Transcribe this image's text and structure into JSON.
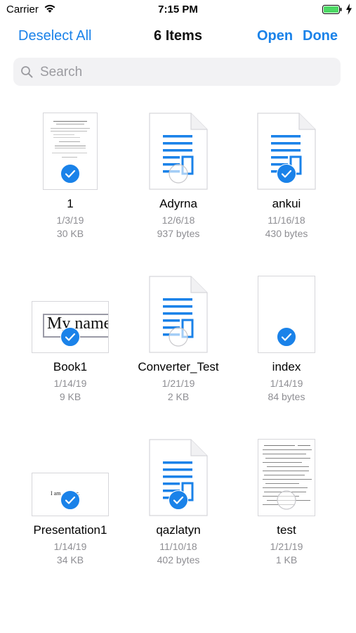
{
  "status_bar": {
    "carrier": "Carrier",
    "time": "7:15 PM",
    "wifi_icon": "wifi-icon",
    "battery_icon": "battery-full-icon",
    "battery_color": "#4cd964"
  },
  "nav": {
    "left": "Deselect All",
    "title": "6 Items",
    "open": "Open",
    "done": "Done",
    "accent_color": "#1a82e9"
  },
  "search": {
    "placeholder": "Search",
    "value": ""
  },
  "files": [
    {
      "name": "1",
      "date": "1/3/19",
      "size": "30 KB",
      "kind": "pdf-thumbnail",
      "selected": true
    },
    {
      "name": "Adyrna",
      "date": "12/6/18",
      "size": "937 bytes",
      "kind": "generic-doc",
      "selected": false
    },
    {
      "name": "ankui",
      "date": "11/16/18",
      "size": "430 bytes",
      "kind": "generic-doc",
      "selected": true
    },
    {
      "name": "Book1",
      "date": "1/14/19",
      "size": "9 KB",
      "kind": "spreadsheet-thumbnail",
      "thumbnail_text": "My name",
      "selected": true
    },
    {
      "name": "Converter_Test",
      "date": "1/21/19",
      "size": "2 KB",
      "kind": "generic-doc",
      "selected": false
    },
    {
      "name": "index",
      "date": "1/14/19",
      "size": "84 bytes",
      "kind": "blank-page",
      "selected": true
    },
    {
      "name": "Presentation1",
      "date": "1/14/19",
      "size": "34 KB",
      "kind": "slide-thumbnail",
      "thumbnail_text": "I am ... rmer.",
      "selected": true
    },
    {
      "name": "qazlatyn",
      "date": "11/10/18",
      "size": "402 bytes",
      "kind": "generic-doc",
      "selected": true
    },
    {
      "name": "test",
      "date": "1/21/19",
      "size": "1 KB",
      "kind": "script-text-thumbnail",
      "selected": false
    }
  ]
}
